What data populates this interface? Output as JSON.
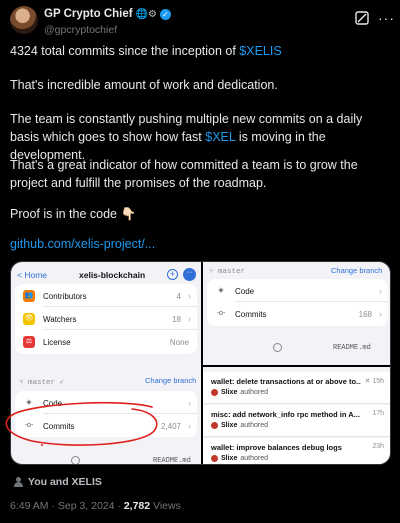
{
  "author": {
    "name": "GP Crypto Chief",
    "name_glyphs": "🌐⚙",
    "handle": "@gpcryptochief"
  },
  "post": {
    "p1_text": "4324 total commits since the inception of ",
    "p1_link": "$XELIS",
    "p2": "That's incredible amount of work and dedication.",
    "p3_pre": "The team is constantly pushing multiple new commits on a daily basis which goes to show how fast ",
    "p3_link": "$XEL",
    "p3_post": " is moving in the development.",
    "p4": "That's a great indicator of how committed a team is to grow the project and fulfill the promises of the roadmap.",
    "p5": "Proof is in the code 👇🏻",
    "url": "github.com/xelis-project/..."
  },
  "screenshot": {
    "left": {
      "back_label": "< Home",
      "repo_title": "xelis-blockchain",
      "rows": [
        {
          "label": "Contributors",
          "value": "4",
          "icon": "contributors-icon",
          "color": "#f57c00"
        },
        {
          "label": "Watchers",
          "value": "18",
          "icon": "watchers-icon",
          "color": "#f5c400"
        },
        {
          "label": "License",
          "value": "None",
          "icon": "license-icon",
          "color": "#e53935"
        }
      ],
      "branch": "master ✓",
      "change_branch": "Change branch",
      "code_label": "Code",
      "commits_label": "Commits",
      "commits_value": "2,407",
      "readme": "README.md"
    },
    "right": {
      "branch": "master",
      "change_branch": "Change branch",
      "code_label": "Code",
      "commits_label": "Commits",
      "commits_value": "168",
      "readme": "README.md",
      "commits": [
        {
          "msg": "wallet: delete transactions at or above to...",
          "time": "15h",
          "author": "Slixe",
          "verb": "authored"
        },
        {
          "msg": "misc: add network_info rpc method in A...",
          "time": "17h",
          "author": "Slixe",
          "verb": "authored"
        },
        {
          "msg": "wallet: improve balances debug logs",
          "time": "23h",
          "author": "Slixe",
          "verb": "authored"
        }
      ]
    },
    "annotation_color": "#e0201a"
  },
  "footer": {
    "liked": "You and XELIS",
    "time": "6:49 AM · Sep 3, 2024 · ",
    "views_count": "2,782",
    "views_label": " Views"
  },
  "colors": {
    "link": "#1d9bf0",
    "background": "#000000",
    "muted": "#71767b"
  }
}
